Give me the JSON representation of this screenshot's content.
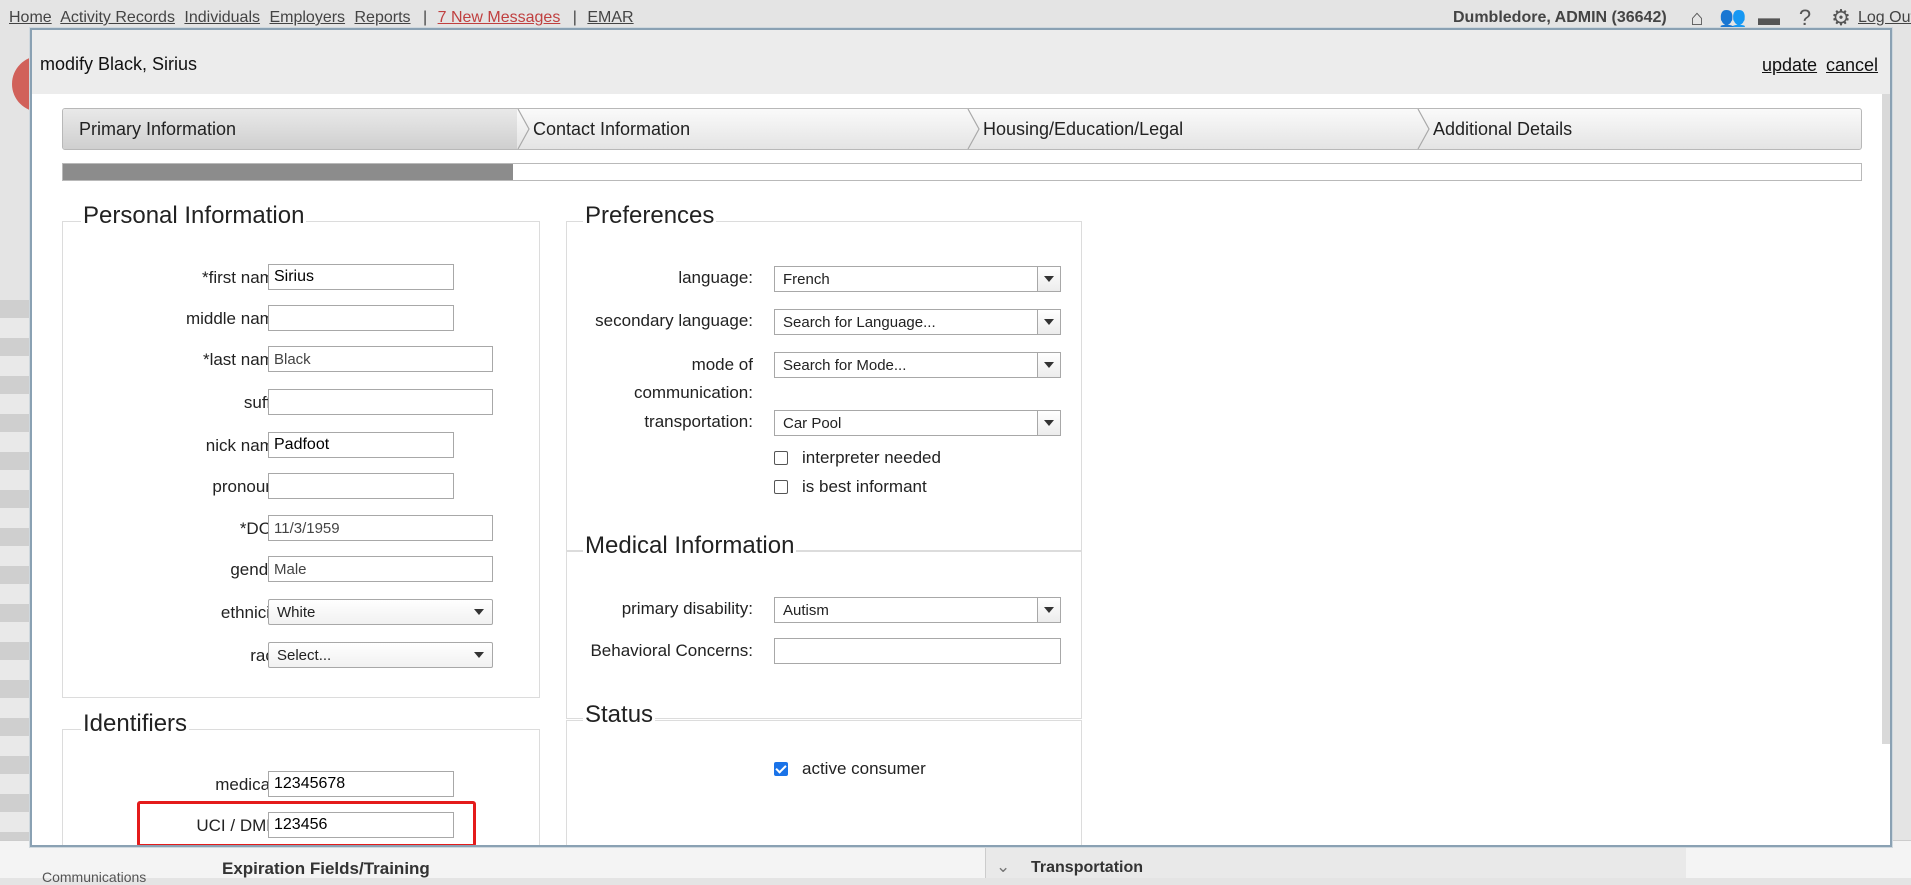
{
  "topnav": {
    "links": [
      "Home",
      "Activity Records",
      "Individuals",
      "Employers",
      "Reports"
    ],
    "messages": "7 New Messages",
    "emar": "EMAR",
    "user": "Dumbledore, ADMIN  (36642)",
    "icons": [
      "home-icon",
      "users-icon",
      "briefcase-icon",
      "help-icon",
      "gear-icon"
    ],
    "logout": "Log Out"
  },
  "background": {
    "bottom_left": "Communications",
    "bottom_mid": "Expiration Fields/Training",
    "bottom_right": "Transportation"
  },
  "modal": {
    "title": "modify Black, Sirius",
    "update": "update",
    "cancel": "cancel",
    "steps": [
      "Primary Information",
      "Contact Information",
      "Housing/Education/Legal",
      "Additional Details"
    ],
    "progress_fraction": 0.25
  },
  "personal": {
    "title": "Personal Information",
    "first_name_label": "*first name:",
    "first_name": "Sirius",
    "middle_name_label": "middle name:",
    "middle_name": "",
    "last_name_label": "*last name:",
    "last_name": "Black",
    "suffix_label": "suffix:",
    "suffix": "",
    "nick_name_label": "nick name:",
    "nick_name": "Padfoot",
    "pronouns_label": "pronouns:",
    "pronouns": "",
    "dob_label": "*DOB:",
    "dob": "11/3/1959",
    "gender_label": "gender:",
    "gender": "Male",
    "ethnicity_label": "ethnicity:",
    "ethnicity": "White",
    "race_label": "race:",
    "race": "Select..."
  },
  "identifiers": {
    "title": "Identifiers",
    "medicaid_label": "medicaid:",
    "medicaid": "12345678",
    "uci_label": "UCI / DMH#",
    "uci": "123456"
  },
  "preferences": {
    "title": "Preferences",
    "language_label": "language:",
    "language": "French",
    "secondary_label": "secondary language:",
    "secondary_placeholder": "Search for Language...",
    "mode_label_1": "mode of",
    "mode_label_2": "communication:",
    "mode_placeholder": "Search for Mode...",
    "transport_label": "transportation:",
    "transport": "Car Pool",
    "interpreter_label": "interpreter needed",
    "interpreter_checked": false,
    "informant_label": "is best informant",
    "informant_checked": false
  },
  "medical": {
    "title": "Medical Information",
    "disability_label": "primary disability:",
    "disability": "Autism",
    "behavioral_label": "Behavioral Concerns:",
    "behavioral": ""
  },
  "status": {
    "title": "Status",
    "active_label": "active consumer",
    "active_checked": true
  },
  "colors": {
    "highlight": "#e41b1b",
    "checkbox": "#1a73e8",
    "messages": "#c04040"
  }
}
